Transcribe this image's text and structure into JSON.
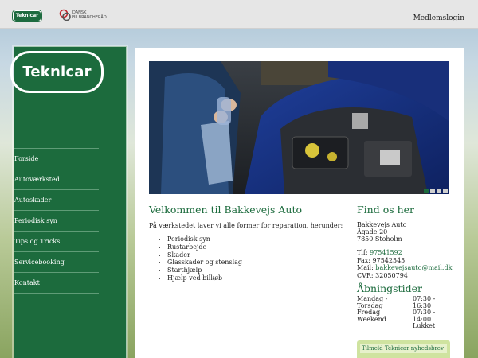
{
  "header": {
    "top_logo": "Teknicar",
    "partner_logo_line1": "DANSK",
    "partner_logo_line2": "BILBRANCHERÅD",
    "member_login": "Medlemslogin"
  },
  "sidebar": {
    "logo": "Teknicar",
    "nav": [
      {
        "label": "Forside"
      },
      {
        "label": "Autoværksted"
      },
      {
        "label": "Autoskader"
      },
      {
        "label": "Periodisk syn"
      },
      {
        "label": "Tips og Tricks"
      },
      {
        "label": "Servicebooking"
      },
      {
        "label": "Kontakt"
      }
    ]
  },
  "main": {
    "welcome_title": "Velkommen til Bakkevejs Auto",
    "intro": "På værkstedet laver vi alle former for reparation, herunder:",
    "services": [
      "Periodisk syn",
      "Rustarbejde",
      "Skader",
      "Glasskader og stenslag",
      "Starthjælp",
      "Hjælp ved bilkøb"
    ]
  },
  "slider": {
    "active_index": 0,
    "count": 4
  },
  "find_us": {
    "title": "Find os her",
    "company": "Bakkevejs Auto",
    "street": "Ågade 20",
    "city": "7850 Stoholm",
    "tlf_label": "Tlf:",
    "tlf": "97541592",
    "fax": "Fax: 97542545",
    "mail_label": "Mail:",
    "mail": "bakkevejsauto@mail.dk",
    "cvr": "CVR: 32050794"
  },
  "hours": {
    "title": "Åbningstider",
    "rows": [
      {
        "day": "Mandag -",
        "time": "07:30 -"
      },
      {
        "day": "Torsdag",
        "time": "16:30"
      },
      {
        "day": "Fredag",
        "time": "07:30 -"
      },
      {
        "day": "Weekend",
        "time": "14:00"
      },
      {
        "day": "",
        "time": "Lukket"
      }
    ]
  },
  "newsletter": {
    "label": "Tilmeld Teknicar nyhedsbrev"
  },
  "colors": {
    "brand_green": "#1c6b3d",
    "newsletter_bg": "#cfe3a0"
  }
}
